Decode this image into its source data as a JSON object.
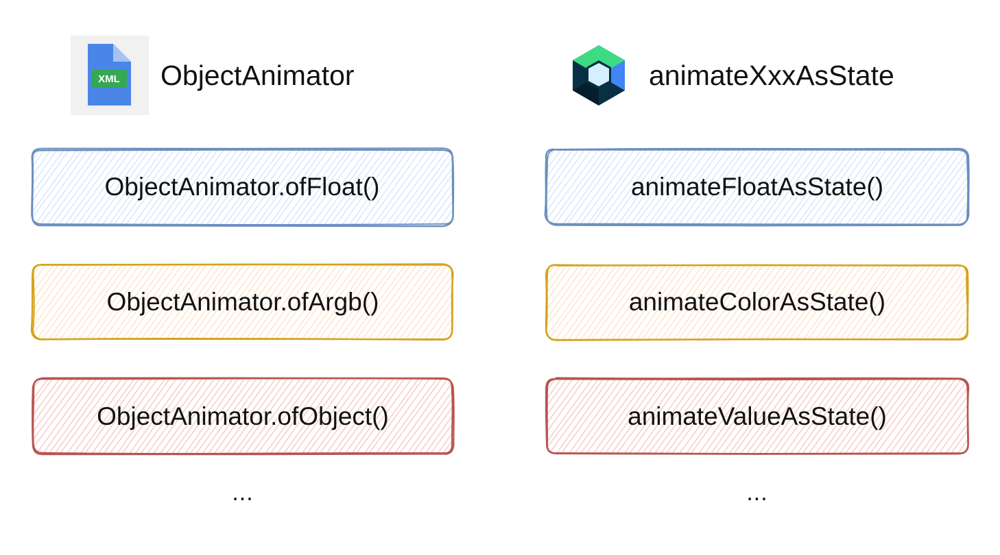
{
  "left": {
    "title": "ObjectAnimator",
    "icon": "xml-file-icon",
    "icon_label": "XML",
    "items": [
      {
        "label": "ObjectAnimator.ofFloat()",
        "color": "blue"
      },
      {
        "label": "ObjectAnimator.ofArgb()",
        "color": "yellow"
      },
      {
        "label": "ObjectAnimator.ofObject()",
        "color": "red"
      }
    ],
    "more": "..."
  },
  "right": {
    "title": "animateXxxAsState",
    "icon": "jetpack-compose-icon",
    "items": [
      {
        "label": "animateFloatAsState()",
        "color": "blue"
      },
      {
        "label": "animateColorAsState()",
        "color": "yellow"
      },
      {
        "label": "animateValueAsState()",
        "color": "red"
      }
    ],
    "more": "..."
  },
  "palette": {
    "blue": {
      "stroke": "#6c8ebf",
      "fill": "#dae8fc"
    },
    "yellow": {
      "stroke": "#d6a21a",
      "fill": "#ffe6cc"
    },
    "red": {
      "stroke": "#b85450",
      "fill": "#f8cecc"
    }
  }
}
